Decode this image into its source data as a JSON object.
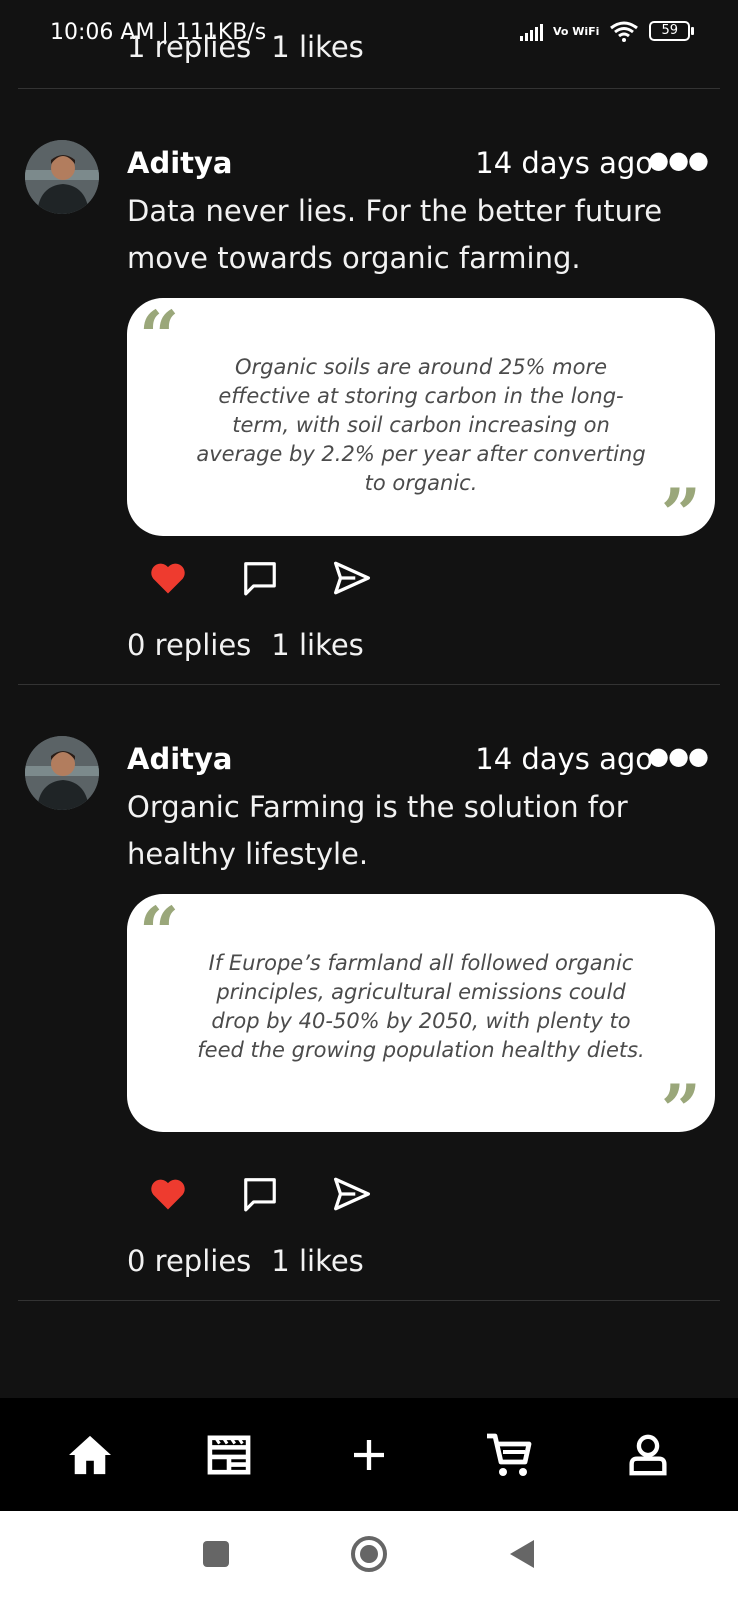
{
  "status": {
    "time": "10:06 AM | 111KB/s",
    "network": "Vo WiFi",
    "battery": "59"
  },
  "top": {
    "replies": "1 replies",
    "likes": "1 likes"
  },
  "posts": [
    {
      "author": "Aditya",
      "time_ago": "14 days ago",
      "text": "Data never lies. For the better future move towards organic farming.",
      "quote": "Organic soils are around 25% more effective at storing carbon in the long-term, with soil carbon increasing on average by 2.2% per year after converting to organic.",
      "replies": "0 replies",
      "likes": "1 likes"
    },
    {
      "author": "Aditya",
      "time_ago": "14 days ago",
      "text": "Organic Farming is the solution for healthy lifestyle.",
      "quote": "If Europe’s farmland all followed organic principles, agricultural emissions could drop by 40-50% by 2050, with plenty to feed the growing population healthy diets.",
      "replies": "0 replies",
      "likes": "1 likes"
    }
  ],
  "nav": [
    "home-icon",
    "feed-icon",
    "add-icon",
    "cart-icon",
    "profile-icon"
  ],
  "colors": {
    "accent_heart": "#ee3b2f",
    "quote_marks": "#9aa77a",
    "background": "#121212"
  }
}
